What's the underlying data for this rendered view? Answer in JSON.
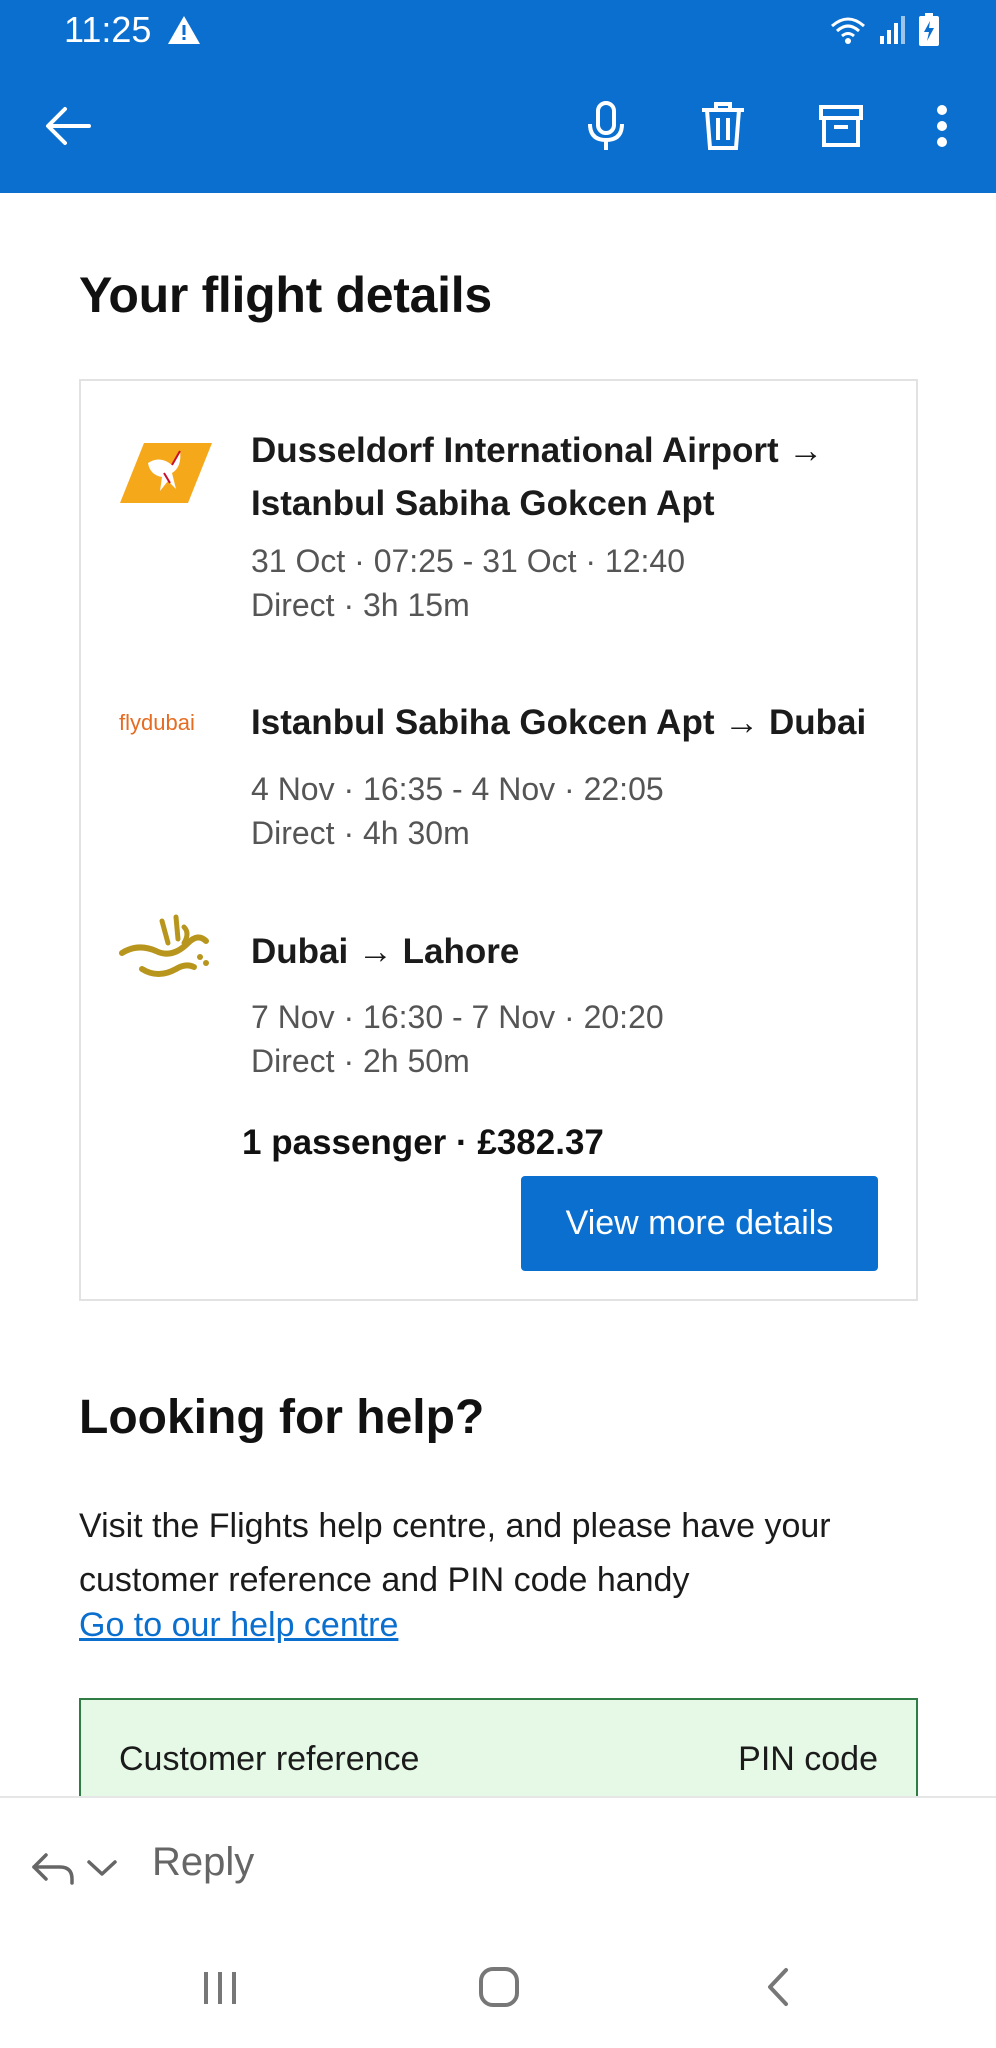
{
  "status_bar": {
    "time": "11:25"
  },
  "content": {
    "heading": "Your flight details",
    "segments": [
      {
        "airline_logo": "pegasus-logo",
        "route": "Dusseldorf International Airport → Istanbul Sabiha Gokcen Apt",
        "times": "31 Oct · 07:25 - 31 Oct · 12:40",
        "duration": "Direct · 3h 15m"
      },
      {
        "airline_logo": "flydubai-logo",
        "logo_text": "flydubai",
        "route": "Istanbul Sabiha Gokcen Apt → Dubai",
        "times": "4 Nov · 16:35 - 4 Nov · 22:05",
        "duration": "Direct · 4h 30m"
      },
      {
        "airline_logo": "emirates-logo",
        "route": "Dubai → Lahore",
        "times": "7 Nov · 16:30 - 7 Nov · 20:20",
        "duration": "Direct · 2h 50m"
      }
    ],
    "summary": "1 passenger · £382.37",
    "cta_label": "View more details",
    "help": {
      "heading": "Looking for help?",
      "text": "Visit the Flights help centre, and please have your customer reference and PIN code handy",
      "link_label": "Go to our help centre",
      "reference_label": "Customer reference",
      "pin_label": "PIN code"
    }
  },
  "reply_bar": {
    "label": "Reply"
  },
  "colors": {
    "appbar": "#0a6fcf",
    "reference_box_bg": "#e6f8e6",
    "reference_box_border": "#2f7d45"
  }
}
